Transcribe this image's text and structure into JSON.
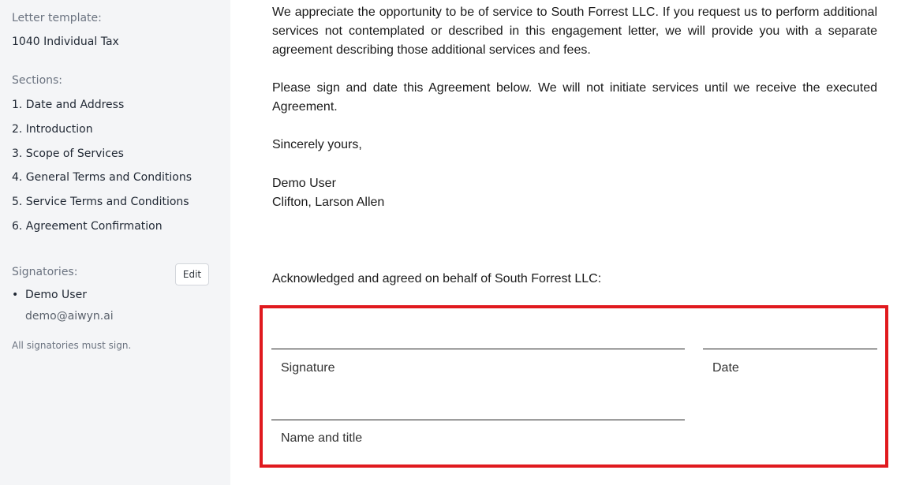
{
  "sidebar": {
    "letter_template_label": "Letter template:",
    "letter_template_value": "1040 Individual Tax",
    "sections_label": "Sections:",
    "sections": [
      "1. Date and Address",
      "2. Introduction",
      "3. Scope of Services",
      "4. General Terms and Conditions",
      "5. Service Terms and Conditions",
      "6. Agreement Confirmation"
    ],
    "signatories_label": "Signatories:",
    "edit_label": "Edit",
    "signatory_name": "Demo User",
    "signatory_email": "demo@aiwyn.ai",
    "note": "All signatories must sign."
  },
  "document": {
    "paragraph_1": "We appreciate the opportunity to be of service to South Forrest LLC. If you request us to perform additional services not contemplated or described in this engagement letter, we will provide you with a separate agreement describing those additional services and fees.",
    "paragraph_2": "Please sign and date this Agreement below. We will not initiate services until we receive the executed Agreement.",
    "closing": "Sincerely yours,",
    "sender_name": "Demo User",
    "sender_firm": "Clifton, Larson Allen",
    "acknowledgement": "Acknowledged and agreed on behalf of South Forrest LLC:"
  },
  "signature_block": {
    "signature_label": "Signature",
    "date_label": "Date",
    "name_title_label": "Name and title"
  },
  "colors": {
    "sidebar_bg": "#f4f5f7",
    "highlight_border": "#e0191e"
  }
}
